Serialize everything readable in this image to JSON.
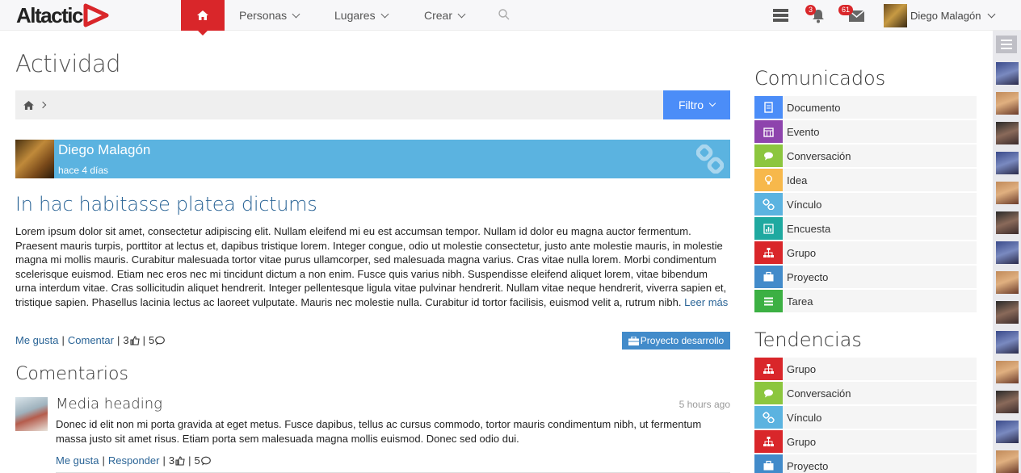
{
  "app": {
    "logo_text": "Altactic"
  },
  "nav": {
    "items": [
      {
        "label": "Personas"
      },
      {
        "label": "Lugares"
      },
      {
        "label": "Crear"
      }
    ],
    "notifications_count": "3",
    "messages_count": "61",
    "user_name": "Diego Malagón"
  },
  "main": {
    "title": "Actividad",
    "filter_label": "Filtro",
    "post": {
      "author": "Diego Malagón",
      "time": "hace 4 días",
      "title": "In hac habitasse platea dictums",
      "body": "Lorem ipsum dolor sit amet, consectetur adipiscing elit. Nullam eleifend mi eu est accumsan tempor. Nullam id dolor eu magna auctor fermentum. Praesent mauris turpis, porttitor at lectus et, dapibus tristique lorem. Integer congue, odio ut molestie consectetur, justo ante molestie mauris, in molestie magna mi mollis mauris. Curabitur malesuada tortor vitae purus ullamcorper, sed malesuada magna varius. Cras vitae nulla lorem. Morbi condimentum scelerisque euismod. Etiam nec eros nec mi tincidunt dictum a non enim. Fusce quis varius nibh. Suspendisse eleifend aliquet lorem, vitae bibendum urna interdum vitae. Cras sollicitudin aliquet hendrerit. Integer pellentesque ligula vitae pulvinar hendrerit. Nullam vitae neque hendrerit, viverra sapien et, tristique sapien. Phasellus lacinia lectus ac laoreet vulputate. Mauris nec molestie nulla. Curabitur id tortor facilisis, euismod velit a, rutrum nibh.",
      "read_more": "Leer más",
      "like_label": "Me gusta",
      "comment_label": "Comentar",
      "likes": "3",
      "comments": "5",
      "project_tag": "Proyecto desarrollo"
    },
    "comments_title": "Comentarios",
    "comment": {
      "heading": "Media heading",
      "time": "5 hours ago",
      "body": "Donec id elit non mi porta gravida at eget metus. Fusce dapibus, tellus ac cursus commodo, tortor mauris condimentum nibh, ut fermentum massa justo sit amet risus. Etiam porta sem malesuada magna mollis euismod. Donec sed odio dui.",
      "like_label": "Me gusta",
      "reply_label": "Responder",
      "likes": "3",
      "comments": "5"
    }
  },
  "sidebar": {
    "communicates_title": "Comunicados",
    "communicates": [
      {
        "label": "Documento",
        "icon": "document-icon",
        "color": "#4b8df8"
      },
      {
        "label": "Evento",
        "icon": "calendar-icon",
        "color": "#8e44ad"
      },
      {
        "label": "Conversación",
        "icon": "chat-icon",
        "color": "#8cc63e"
      },
      {
        "label": "Idea",
        "icon": "lightbulb-icon",
        "color": "#f7b84b"
      },
      {
        "label": "Vínculo",
        "icon": "link-icon",
        "color": "#5bb3e0"
      },
      {
        "label": "Encuesta",
        "icon": "chart-icon",
        "color": "#1fa9a0"
      },
      {
        "label": "Grupo",
        "icon": "sitemap-icon",
        "color": "#d9262a"
      },
      {
        "label": "Proyecto",
        "icon": "briefcase-icon",
        "color": "#428bca"
      },
      {
        "label": "Tarea",
        "icon": "list-icon",
        "color": "#3cb043"
      }
    ],
    "trends_title": "Tendencias",
    "trends": [
      {
        "label": "Grupo",
        "icon": "sitemap-icon",
        "color": "#d9262a"
      },
      {
        "label": "Conversación",
        "icon": "chat-icon",
        "color": "#8cc63e"
      },
      {
        "label": "Vínculo",
        "icon": "link-icon",
        "color": "#5bb3e0"
      },
      {
        "label": "Grupo",
        "icon": "sitemap-icon",
        "color": "#d9262a"
      },
      {
        "label": "Proyecto",
        "icon": "briefcase-icon",
        "color": "#428bca"
      }
    ]
  }
}
